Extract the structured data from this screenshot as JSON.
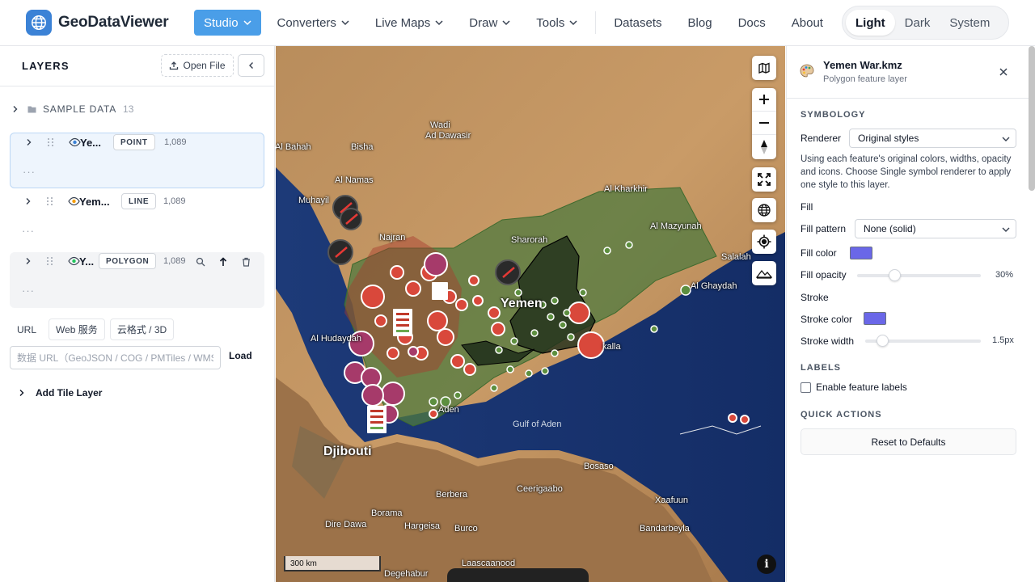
{
  "header": {
    "brand": "GeoDataViewer",
    "nav": [
      {
        "label": "Studio",
        "dropdown": true,
        "active": true
      },
      {
        "label": "Converters",
        "dropdown": true
      },
      {
        "label": "Live Maps",
        "dropdown": true
      },
      {
        "label": "Draw",
        "dropdown": true
      },
      {
        "label": "Tools",
        "dropdown": true
      }
    ],
    "links": [
      "Datasets",
      "Blog",
      "Docs",
      "About"
    ],
    "theme": {
      "options": [
        "Light",
        "Dark",
        "System"
      ],
      "selected": "Light"
    }
  },
  "left": {
    "title": "LAYERS",
    "open_file": "Open File",
    "sample": {
      "label": "SAMPLE DATA",
      "count": "13"
    },
    "layers": [
      {
        "name": "Ye...",
        "type": "POINT",
        "count": "1,089",
        "more": "···"
      },
      {
        "name": "Yem...",
        "type": "LINE",
        "count": "1,089",
        "more": "···"
      },
      {
        "name": "Y...",
        "type": "POLYGON",
        "count": "1,089",
        "more": "···"
      }
    ],
    "source_tabs": [
      "URL",
      "Web 服务",
      "云格式 / 3D"
    ],
    "url_placeholder": "数据 URL（GeoJSON / COG / PMTiles / WMS）",
    "load": "Load",
    "add_tile": "Add Tile Layer"
  },
  "map": {
    "labels": {
      "wadi": "Wadi",
      "addawasir": "Ad Dawasir",
      "albahah": "Al Bahah",
      "bisha": "Bisha",
      "alnamas": "Al Namas",
      "muhayil": "Muhayil",
      "najran": "Najran",
      "sharorah": "Sharorah",
      "alkharkhir": "Al Kharkhir",
      "almazyunah": "Al Mazyunah",
      "salalah": "Salalah",
      "alghaydah": "Al Ghaydah",
      "yemen": "Yemen",
      "alhudaydah": "Al Hudaydah",
      "mukalla": "kalla",
      "aden": "Aden",
      "gulf": "Gulf of Aden",
      "djibouti": "Djibouti",
      "bosaso": "Bosaso",
      "berbera": "Berbera",
      "ceerigaabo": "Ceerigaabo",
      "xaafuun": "Xaafuun",
      "diredawa": "Dire Dawa",
      "borama": "Borama",
      "hargeisa": "Hargeisa",
      "burco": "Burco",
      "bandarbeyla": "Bandarbeyla",
      "laascaanood": "Laascaanood",
      "degehabur": "Degehabur"
    },
    "scale": "300 km",
    "info": "i"
  },
  "right": {
    "title": "Yemen War.kmz",
    "subtitle": "Polygon feature layer",
    "symbology": "SYMBOLOGY",
    "renderer_label": "Renderer",
    "renderer_value": "Original styles",
    "description": "Using each feature's original colors, widths, opacity and icons. Choose Single symbol renderer to apply one style to this layer.",
    "fill": "Fill",
    "fill_pattern_label": "Fill pattern",
    "fill_pattern_value": "None (solid)",
    "fill_color_label": "Fill color",
    "fill_color": "#6a67e8",
    "fill_opacity_label": "Fill opacity",
    "fill_opacity": "30%",
    "fill_opacity_fraction": 0.3,
    "stroke": "Stroke",
    "stroke_color_label": "Stroke color",
    "stroke_color": "#6a67e8",
    "stroke_width_label": "Stroke width",
    "stroke_width": "1.5px",
    "stroke_width_fraction": 0.15,
    "labels": "LABELS",
    "enable_labels": "Enable feature labels",
    "quick_actions": "QUICK ACTIONS",
    "reset": "Reset to Defaults"
  }
}
